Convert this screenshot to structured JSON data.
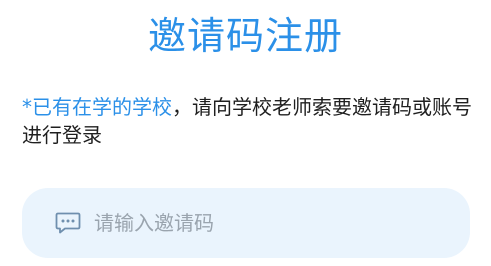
{
  "title": "邀请码注册",
  "notice": {
    "highlight": "*已有在学的学校",
    "body": "，请向学校老师索要邀请码或账号进行登录"
  },
  "invite_input": {
    "placeholder": "请输入邀请码",
    "value": "",
    "icon": "chat-bubble-icon"
  },
  "colors": {
    "accent": "#2b90e8",
    "input_bg": "#eaf4fd",
    "placeholder": "#9aa4ae"
  }
}
